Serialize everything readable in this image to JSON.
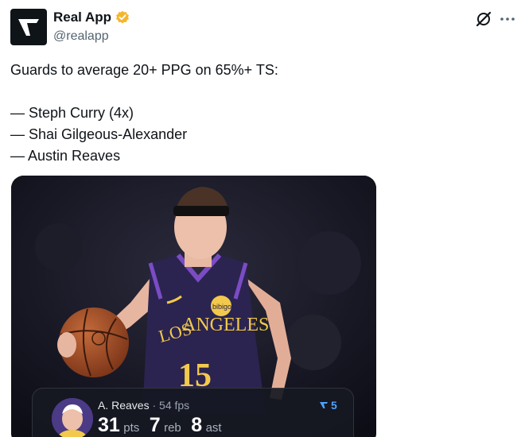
{
  "author": {
    "display_name": "Real App",
    "handle": "@realapp",
    "verified": true,
    "avatar_icon": "real-app-logo-icon"
  },
  "actions": {
    "grok_icon": "grok-icon",
    "more_icon": "more-horizontal-icon"
  },
  "tweet": {
    "lines": [
      "Guards to average 20+ PPG on 65%+ TS:",
      "",
      "— Steph Curry (4x)",
      "— Shai Gilgeous-Alexander",
      "— Austin Reaves"
    ]
  },
  "media": {
    "jersey_lettering": "LOS ANGELES",
    "jersey_number": "15",
    "sponsor_patch": "bibigo"
  },
  "stat_card": {
    "player": "A. Reaves",
    "separator": "·",
    "fps": "54 fps",
    "pts_value": "31",
    "pts_label": "pts",
    "reb_value": "7",
    "reb_label": "reb",
    "ast_value": "8",
    "ast_label": "ast",
    "badge_count": "5",
    "badge_icon": "real-app-logo-icon"
  },
  "colors": {
    "verified_badge": "#f4b62e",
    "text_primary": "#0f1419",
    "text_secondary": "#536471",
    "badge_blue": "#4ea1ff"
  }
}
